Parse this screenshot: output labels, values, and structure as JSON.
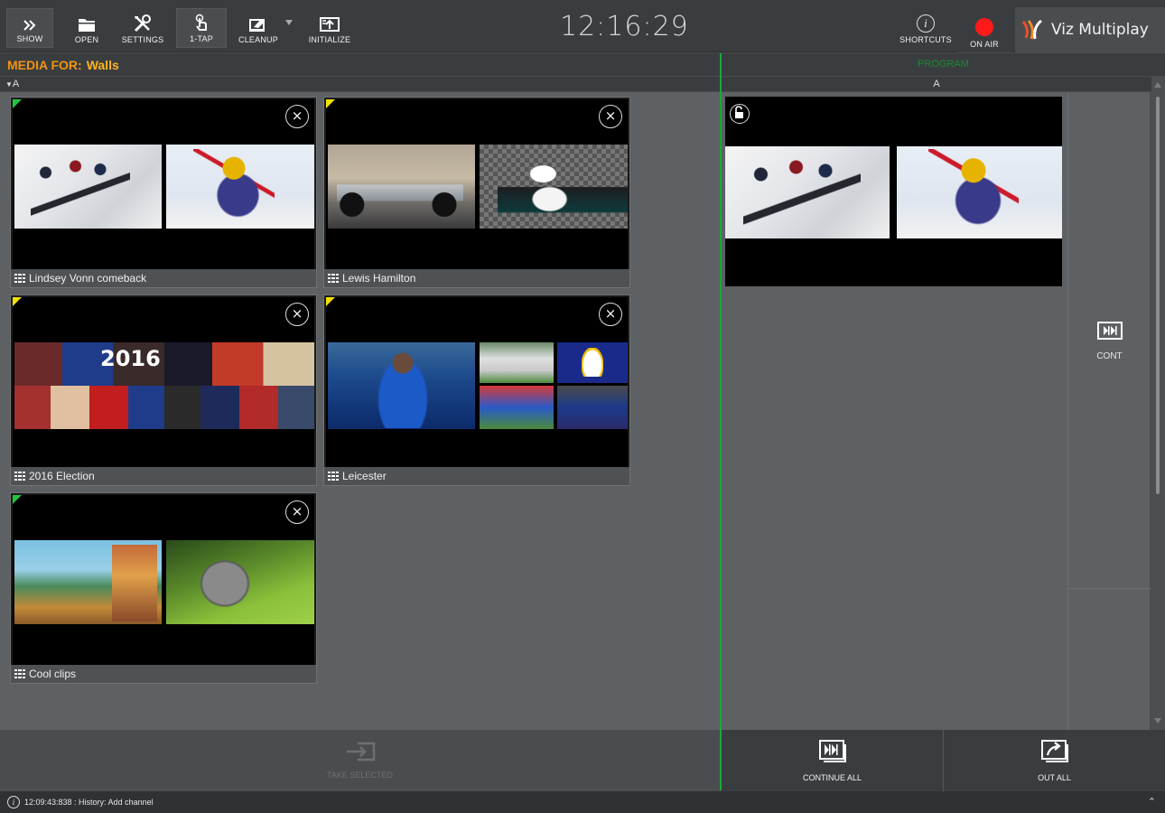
{
  "toolbar": {
    "show_label": "SHOW",
    "open_label": "OPEN",
    "settings_label": "SETTINGS",
    "one_tap_label": "1-TAP",
    "cleanup_label": "CLEANUP",
    "initialize_label": "INITIALIZE",
    "clock": "12:16:29",
    "shortcuts_label": "SHORTCUTS",
    "on_air_label": "ON AIR",
    "app_name": "Viz Multiplay"
  },
  "media": {
    "header_prefix": "MEDIA FOR:",
    "header_name": "Walls",
    "section_label": "A",
    "cards": [
      {
        "title": "Lindsey Vonn comeback",
        "corner_color": "#22c43a"
      },
      {
        "title": "Lewis Hamilton",
        "corner_color": "#f0e000"
      },
      {
        "title": "2016 Election",
        "corner_color": "#f0e000"
      },
      {
        "title": "Leicester",
        "corner_color": "#f0e000"
      },
      {
        "title": "Cool clips",
        "corner_color": "#22c43a"
      }
    ],
    "take_selected_label": "TAKE SELECTED"
  },
  "program": {
    "header": "PROGRAM",
    "section_label": "A",
    "cont_label": "CONT",
    "continue_all_label": "CONTINUE ALL",
    "out_all_label": "OUT ALL"
  },
  "status": {
    "message": "12:09:43:838 : History: Add channel"
  },
  "colors": {
    "accent_orange": "#f0940e",
    "program_green": "#1aa83a",
    "on_air_red": "#ff1a1a"
  }
}
